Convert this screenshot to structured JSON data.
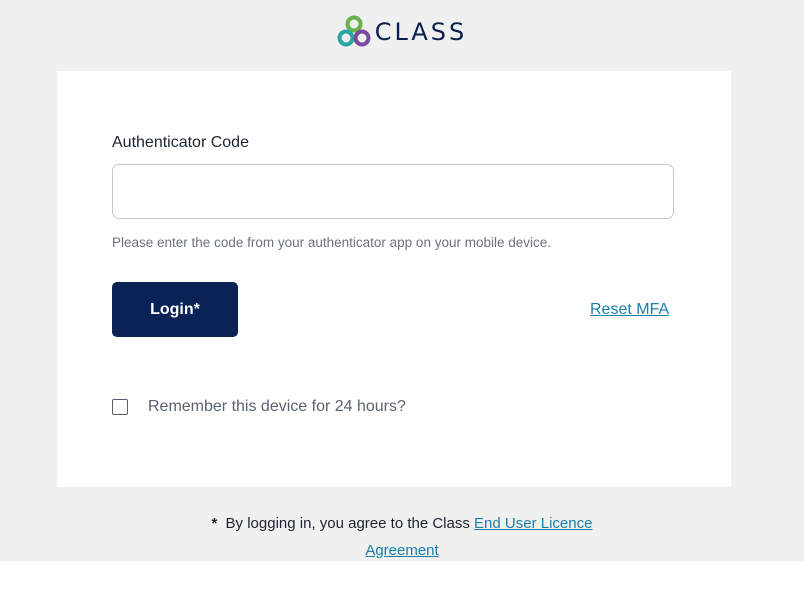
{
  "brand": {
    "name": "CLASS",
    "colors": {
      "navy": "#0b2257",
      "teal": "#2aa6a0",
      "green": "#6ab04c",
      "purple": "#7b4a9e"
    }
  },
  "form": {
    "code_label": "Authenticator Code",
    "code_value": "",
    "code_placeholder": "",
    "hint": "Please enter the code from your authenticator app on your mobile device.",
    "login_label": "Login*",
    "reset_label": "Reset MFA",
    "remember_label": "Remember this device for 24 hours?",
    "remember_checked": false
  },
  "footer": {
    "asterisk": "*",
    "prefix": "By logging in, you agree to the Class",
    "link_line1": "End User Licence",
    "link_line2": "Agreement"
  },
  "icons": {
    "logo": "class-logo-icon",
    "checkbox": "checkbox-icon"
  }
}
